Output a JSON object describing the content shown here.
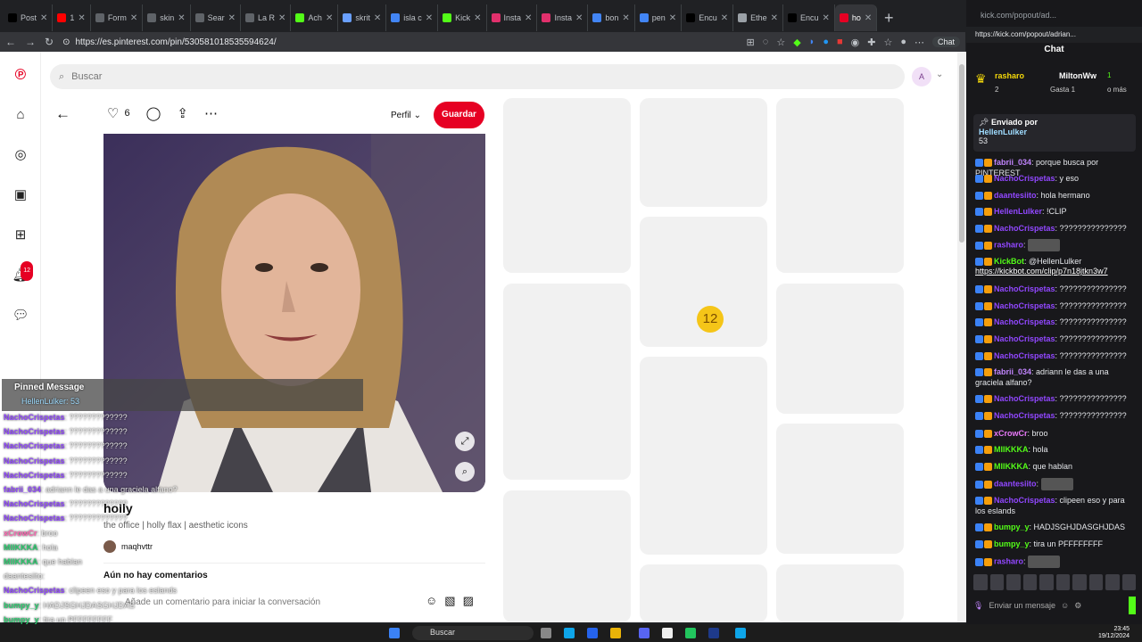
{
  "browser": {
    "tabs": [
      {
        "label": "Post",
        "color": "#000000"
      },
      {
        "label": "1",
        "color": "#ff0000"
      },
      {
        "label": "Form",
        "color": "#5f6368"
      },
      {
        "label": "skin",
        "color": "#5f6368"
      },
      {
        "label": "Sear",
        "color": "#5f6368"
      },
      {
        "label": "La R",
        "color": "#5f6368"
      },
      {
        "label": "Ach",
        "color": "#53fc18"
      },
      {
        "label": "skrit",
        "color": "#6aa0ff"
      },
      {
        "label": "isla c",
        "color": "#4285f4"
      },
      {
        "label": "Kick",
        "color": "#53fc18"
      },
      {
        "label": "Insta",
        "color": "#e1306c"
      },
      {
        "label": "Insta",
        "color": "#e1306c"
      },
      {
        "label": "bon",
        "color": "#4285f4"
      },
      {
        "label": "pen",
        "color": "#4285f4"
      },
      {
        "label": "Encu",
        "color": "#000000"
      },
      {
        "label": "Ethe",
        "color": "#9aa0a6"
      },
      {
        "label": "Encu",
        "color": "#000000"
      },
      {
        "label": "ho",
        "color": "#e60023"
      }
    ],
    "url": "https://es.pinterest.com/pin/530581018535594624/",
    "chat_button": "Chat"
  },
  "pinterest": {
    "search_placeholder": "Buscar",
    "avatar_letter": "A",
    "likes": "6",
    "profile_label": "Perfil",
    "save_label": "Guardar",
    "title": "holly",
    "description": "the office | holly flax | aesthetic icons",
    "author": "maqhvttr",
    "no_comments": "Aún no hay comentarios",
    "comment_placeholder": "Añade un comentario para iniciar la conversación",
    "notifications_badge": "12",
    "emoji_label": "12"
  },
  "overlay_chat": {
    "pinned_title": "Pinned Message",
    "pinned_user": "HellenLulker: 53",
    "lines": [
      {
        "user": "NachoCrispetas",
        "text": "?????????????",
        "cls": "n"
      },
      {
        "user": "NachoCrispetas",
        "text": "?????????????",
        "cls": "n"
      },
      {
        "user": "NachoCrispetas",
        "text": "?????????????",
        "cls": "n"
      },
      {
        "user": "NachoCrispetas",
        "text": "?????????????",
        "cls": "n"
      },
      {
        "user": "NachoCrispetas",
        "text": "?????????????",
        "cls": "n"
      },
      {
        "user": "fabrii_034",
        "text": "adriann le das a una graciela alfano?",
        "cls": "n"
      },
      {
        "user": "NachoCrispetas",
        "text": "?????????????",
        "cls": "n"
      },
      {
        "user": "NachoCrispetas",
        "text": "?????????????",
        "cls": "n"
      },
      {
        "user": "xCrowCr",
        "text": "broo",
        "cls": "m"
      },
      {
        "user": "MIIKKKA",
        "text": "hola",
        "cls": "g"
      },
      {
        "user": "MIIKKKA",
        "text": "que hablan",
        "cls": "g"
      },
      {
        "user": "daantesiito",
        "text": "",
        "cls": "o"
      },
      {
        "user": "NachoCrispetas",
        "text": "clipeen eso y para los eslands",
        "cls": "n"
      },
      {
        "user": "bumpy_y",
        "text": "HADJSGHJDASGHJDAS",
        "cls": "g"
      },
      {
        "user": "bumpy_y",
        "text": "tira un PFFFFFFFF",
        "cls": "g"
      }
    ],
    "streamer": "rasharo"
  },
  "kick": {
    "window_title": "kick.com/popout/ad...",
    "url": "https://kick.com/popout/adrian...",
    "header": "Chat",
    "gifter_1": "rasharo",
    "gifter_1_count": "2",
    "gifter_2": "MiltonWw",
    "gifter_2_count": "1",
    "gift_text": "Gasta 1",
    "gift_more": "o más",
    "pinned_by_label": "Enviado por",
    "pinned_user": "HellenLulker",
    "pinned_text": "53",
    "messages": [
      {
        "user": "fabrii_034",
        "text": "porque busca por PINTEREST",
        "cls": "c"
      },
      {
        "user": "NachoCrispetas",
        "text": "y eso",
        "cls": "n"
      },
      {
        "user": "daantesiito",
        "text": "hola hermano",
        "cls": "n"
      },
      {
        "user": "HellenLulker",
        "text": "!CLIP",
        "cls": "n"
      },
      {
        "user": "NachoCrispetas",
        "text": "???????????????",
        "cls": "n"
      },
      {
        "user": "rasharo",
        "text": "",
        "cls": "n"
      },
      {
        "user": "KickBot",
        "text": "@HellenLulker",
        "cls": "g"
      },
      {
        "user": "",
        "text": "https://kickbot.com/clip/p7n18jtkn3w7",
        "cls": "link"
      },
      {
        "user": "NachoCrispetas",
        "text": "???????????????",
        "cls": "n"
      },
      {
        "user": "NachoCrispetas",
        "text": "???????????????",
        "cls": "n"
      },
      {
        "user": "NachoCrispetas",
        "text": "???????????????",
        "cls": "n"
      },
      {
        "user": "NachoCrispetas",
        "text": "???????????????",
        "cls": "n"
      },
      {
        "user": "NachoCrispetas",
        "text": "???????????????",
        "cls": "n"
      },
      {
        "user": "fabrii_034",
        "text": "adriann le das a una graciela alfano?",
        "cls": "c"
      },
      {
        "user": "NachoCrispetas",
        "text": "???????????????",
        "cls": "n"
      },
      {
        "user": "NachoCrispetas",
        "text": "???????????????",
        "cls": "n"
      },
      {
        "user": "xCrowCr",
        "text": "broo",
        "cls": "p"
      },
      {
        "user": "MIIKKKA",
        "text": "hola",
        "cls": "g"
      },
      {
        "user": "MIIKKKA",
        "text": "que hablan",
        "cls": "g"
      },
      {
        "user": "daantesiito",
        "text": "",
        "cls": "n"
      },
      {
        "user": "NachoCrispetas",
        "text": "clipeen eso y para los eslands",
        "cls": "n"
      },
      {
        "user": "bumpy_y",
        "text": "HADJSGHJDASGHJDAS",
        "cls": "g"
      },
      {
        "user": "bumpy_y",
        "text": "tira un PFFFFFFFF",
        "cls": "g"
      },
      {
        "user": "rasharo",
        "text": "",
        "cls": "n"
      }
    ],
    "input_placeholder": "Enviar un mensaje"
  },
  "taskbar": {
    "search_label": "Buscar",
    "time": "23:45",
    "date": "19/12/2024"
  }
}
